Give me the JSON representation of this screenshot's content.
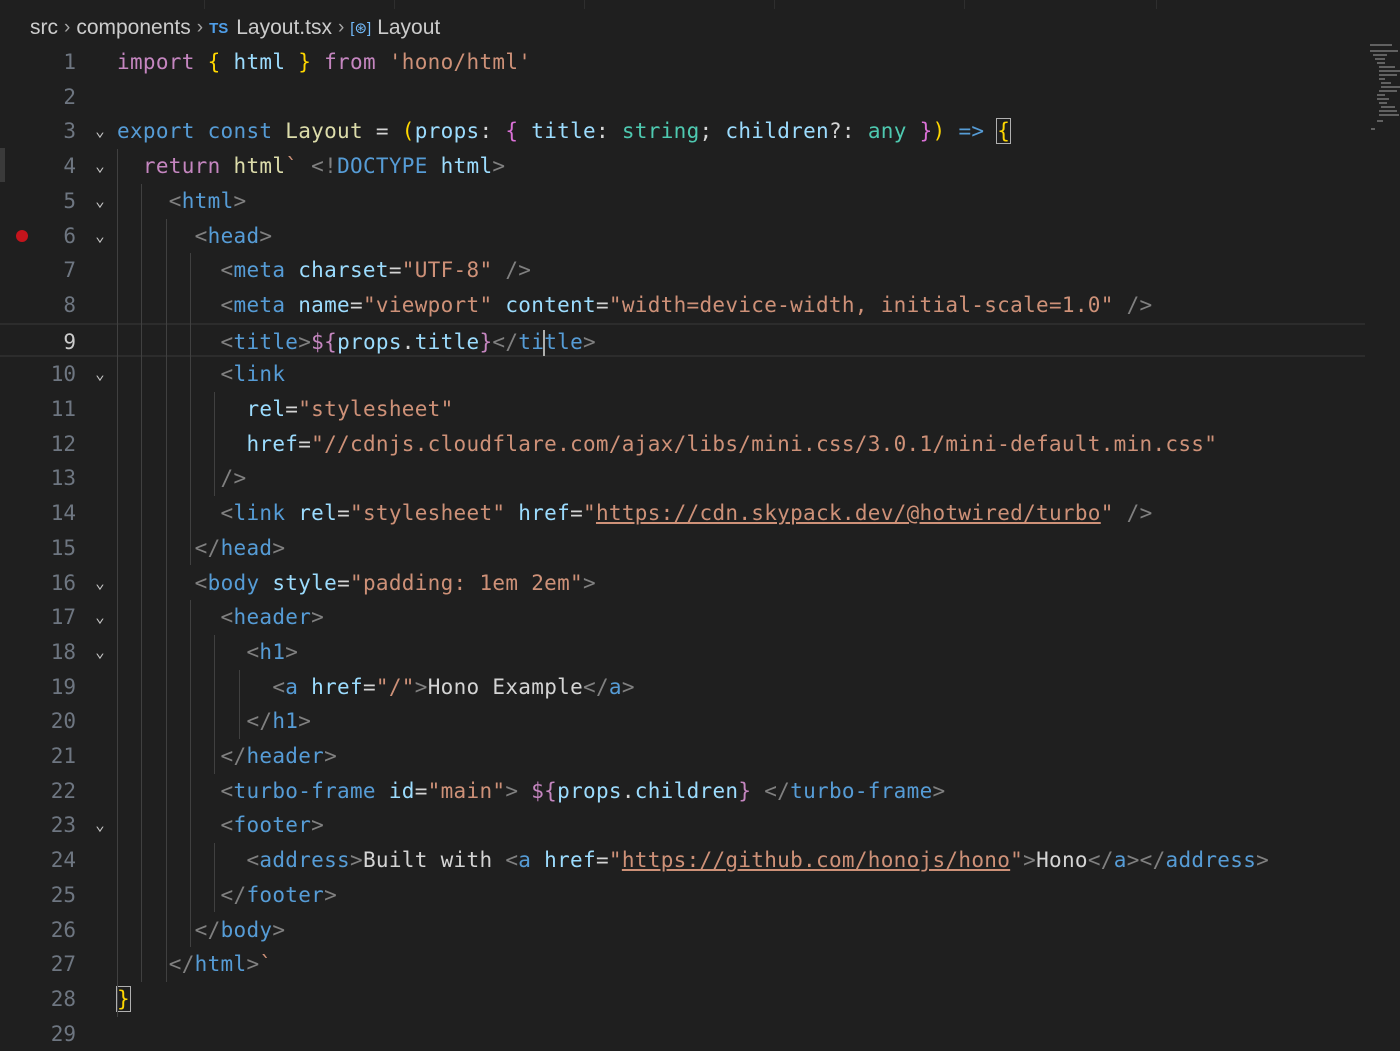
{
  "breadcrumb": {
    "items": [
      {
        "label": "src",
        "badge": ""
      },
      {
        "label": "components",
        "badge": ""
      },
      {
        "label": "Layout.tsx",
        "badge": "TS"
      },
      {
        "label": "Layout",
        "badge": "symbol"
      }
    ]
  },
  "editor": {
    "current_line": 9,
    "breakpoint_line": 6,
    "lines": [
      {
        "n": "1",
        "fold": false,
        "tokens": [
          [
            "t-kw",
            "import "
          ],
          [
            "t-b1",
            "{ "
          ],
          [
            "t-id",
            "html"
          ],
          [
            "t-b1",
            " }"
          ],
          [
            "t-kw",
            " from "
          ],
          [
            "t-st",
            "'hono/html'"
          ]
        ]
      },
      {
        "n": "2",
        "fold": false,
        "tokens": []
      },
      {
        "n": "3",
        "fold": true,
        "tokens": [
          [
            "t-tg",
            "export "
          ],
          [
            "t-tg",
            "const "
          ],
          [
            "t-fn",
            "Layout"
          ],
          [
            "t-df",
            " = "
          ],
          [
            "t-b1",
            "("
          ],
          [
            "t-id",
            "props"
          ],
          [
            "t-df",
            ": "
          ],
          [
            "t-b2",
            "{ "
          ],
          [
            "t-id",
            "title"
          ],
          [
            "t-df",
            ": "
          ],
          [
            "t-ty",
            "string"
          ],
          [
            "t-df",
            "; "
          ],
          [
            "t-id",
            "children"
          ],
          [
            "t-df",
            "?: "
          ],
          [
            "t-ty",
            "any"
          ],
          [
            "t-b2",
            " }"
          ],
          [
            "t-b1",
            ")"
          ],
          [
            "t-tg",
            " => "
          ],
          [
            "t-b1 bm",
            "{"
          ]
        ]
      },
      {
        "n": "4",
        "fold": true,
        "tokens": [
          [
            "t-df",
            "  "
          ],
          [
            "t-kw",
            "return "
          ],
          [
            "t-fn",
            "html"
          ],
          [
            "t-st",
            "` "
          ],
          [
            "t-pu",
            "<!"
          ],
          [
            "t-tg",
            "DOCTYPE "
          ],
          [
            "t-id",
            "html"
          ],
          [
            "t-pu",
            ">"
          ]
        ]
      },
      {
        "n": "5",
        "fold": true,
        "tokens": [
          [
            "t-df",
            "    "
          ],
          [
            "t-pu",
            "<"
          ],
          [
            "t-tg",
            "html"
          ],
          [
            "t-pu",
            ">"
          ]
        ]
      },
      {
        "n": "6",
        "fold": true,
        "tokens": [
          [
            "t-df",
            "      "
          ],
          [
            "t-pu",
            "<"
          ],
          [
            "t-tg",
            "head"
          ],
          [
            "t-pu",
            ">"
          ]
        ]
      },
      {
        "n": "7",
        "fold": false,
        "tokens": [
          [
            "t-df",
            "        "
          ],
          [
            "t-pu",
            "<"
          ],
          [
            "t-tg",
            "meta "
          ],
          [
            "t-id",
            "charset"
          ],
          [
            "t-df",
            "="
          ],
          [
            "t-st",
            "\"UTF-8\""
          ],
          [
            "t-pu",
            " />"
          ]
        ]
      },
      {
        "n": "8",
        "fold": false,
        "tokens": [
          [
            "t-df",
            "        "
          ],
          [
            "t-pu",
            "<"
          ],
          [
            "t-tg",
            "meta "
          ],
          [
            "t-id",
            "name"
          ],
          [
            "t-df",
            "="
          ],
          [
            "t-st",
            "\"viewport\" "
          ],
          [
            "t-id",
            "content"
          ],
          [
            "t-df",
            "="
          ],
          [
            "t-st",
            "\"width=device-width, initial-scale=1.0\""
          ],
          [
            "t-pu",
            " />"
          ]
        ]
      },
      {
        "n": "9",
        "fold": false,
        "tokens": [
          [
            "t-df",
            "        "
          ],
          [
            "t-pu",
            "<"
          ],
          [
            "t-tg",
            "title"
          ],
          [
            "t-pu",
            ">"
          ],
          [
            "t-kw",
            "${"
          ],
          [
            "t-id",
            "props"
          ],
          [
            "t-df",
            "."
          ],
          [
            "t-id",
            "title"
          ],
          [
            "t-kw",
            "}"
          ],
          [
            "t-pu",
            "</"
          ],
          [
            "t-tg",
            "ti"
          ],
          [
            "caret",
            ""
          ],
          [
            "t-tg",
            "tle"
          ],
          [
            "t-pu",
            ">"
          ]
        ]
      },
      {
        "n": "10",
        "fold": true,
        "tokens": [
          [
            "t-df",
            "        "
          ],
          [
            "t-pu",
            "<"
          ],
          [
            "t-tg",
            "link"
          ]
        ]
      },
      {
        "n": "11",
        "fold": false,
        "tokens": [
          [
            "t-df",
            "          "
          ],
          [
            "t-id",
            "rel"
          ],
          [
            "t-df",
            "="
          ],
          [
            "t-st",
            "\"stylesheet\""
          ]
        ]
      },
      {
        "n": "12",
        "fold": false,
        "tokens": [
          [
            "t-df",
            "          "
          ],
          [
            "t-id",
            "href"
          ],
          [
            "t-df",
            "="
          ],
          [
            "t-st",
            "\"//cdnjs.cloudflare.com/ajax/libs/mini.css/3.0.1/mini-default.min.css\""
          ]
        ]
      },
      {
        "n": "13",
        "fold": false,
        "tokens": [
          [
            "t-df",
            "        "
          ],
          [
            "t-pu",
            "/>"
          ]
        ]
      },
      {
        "n": "14",
        "fold": false,
        "tokens": [
          [
            "t-df",
            "        "
          ],
          [
            "t-pu",
            "<"
          ],
          [
            "t-tg",
            "link "
          ],
          [
            "t-id",
            "rel"
          ],
          [
            "t-df",
            "="
          ],
          [
            "t-st",
            "\"stylesheet\" "
          ],
          [
            "t-id",
            "href"
          ],
          [
            "t-df",
            "="
          ],
          [
            "t-st",
            "\""
          ],
          [
            "t-ln",
            "https://cdn.skypack.dev/@hotwired/turbo"
          ],
          [
            "t-st",
            "\""
          ],
          [
            "t-pu",
            " />"
          ]
        ]
      },
      {
        "n": "15",
        "fold": false,
        "tokens": [
          [
            "t-df",
            "      "
          ],
          [
            "t-pu",
            "</"
          ],
          [
            "t-tg",
            "head"
          ],
          [
            "t-pu",
            ">"
          ]
        ]
      },
      {
        "n": "16",
        "fold": true,
        "tokens": [
          [
            "t-df",
            "      "
          ],
          [
            "t-pu",
            "<"
          ],
          [
            "t-tg",
            "body "
          ],
          [
            "t-id",
            "style"
          ],
          [
            "t-df",
            "="
          ],
          [
            "t-st",
            "\"padding: 1em 2em\""
          ],
          [
            "t-pu",
            ">"
          ]
        ]
      },
      {
        "n": "17",
        "fold": true,
        "tokens": [
          [
            "t-df",
            "        "
          ],
          [
            "t-pu",
            "<"
          ],
          [
            "t-tg",
            "header"
          ],
          [
            "t-pu",
            ">"
          ]
        ]
      },
      {
        "n": "18",
        "fold": true,
        "tokens": [
          [
            "t-df",
            "          "
          ],
          [
            "t-pu",
            "<"
          ],
          [
            "t-tg",
            "h1"
          ],
          [
            "t-pu",
            ">"
          ]
        ]
      },
      {
        "n": "19",
        "fold": false,
        "tokens": [
          [
            "t-df",
            "            "
          ],
          [
            "t-pu",
            "<"
          ],
          [
            "t-tg",
            "a "
          ],
          [
            "t-id",
            "href"
          ],
          [
            "t-df",
            "="
          ],
          [
            "t-st",
            "\"/\""
          ],
          [
            "t-pu",
            ">"
          ],
          [
            "t-df",
            "Hono Example"
          ],
          [
            "t-pu",
            "</"
          ],
          [
            "t-tg",
            "a"
          ],
          [
            "t-pu",
            ">"
          ]
        ]
      },
      {
        "n": "20",
        "fold": false,
        "tokens": [
          [
            "t-df",
            "          "
          ],
          [
            "t-pu",
            "</"
          ],
          [
            "t-tg",
            "h1"
          ],
          [
            "t-pu",
            ">"
          ]
        ]
      },
      {
        "n": "21",
        "fold": false,
        "tokens": [
          [
            "t-df",
            "        "
          ],
          [
            "t-pu",
            "</"
          ],
          [
            "t-tg",
            "header"
          ],
          [
            "t-pu",
            ">"
          ]
        ]
      },
      {
        "n": "22",
        "fold": false,
        "tokens": [
          [
            "t-df",
            "        "
          ],
          [
            "t-pu",
            "<"
          ],
          [
            "t-tg",
            "turbo-frame "
          ],
          [
            "t-id",
            "id"
          ],
          [
            "t-df",
            "="
          ],
          [
            "t-st",
            "\"main\""
          ],
          [
            "t-pu",
            "> "
          ],
          [
            "t-kw",
            "${"
          ],
          [
            "t-id",
            "props"
          ],
          [
            "t-df",
            "."
          ],
          [
            "t-id",
            "children"
          ],
          [
            "t-kw",
            "}"
          ],
          [
            "t-pu",
            " </"
          ],
          [
            "t-tg",
            "turbo-frame"
          ],
          [
            "t-pu",
            ">"
          ]
        ]
      },
      {
        "n": "23",
        "fold": true,
        "tokens": [
          [
            "t-df",
            "        "
          ],
          [
            "t-pu",
            "<"
          ],
          [
            "t-tg",
            "footer"
          ],
          [
            "t-pu",
            ">"
          ]
        ]
      },
      {
        "n": "24",
        "fold": false,
        "tokens": [
          [
            "t-df",
            "          "
          ],
          [
            "t-pu",
            "<"
          ],
          [
            "t-tg",
            "address"
          ],
          [
            "t-pu",
            ">"
          ],
          [
            "t-df",
            "Built with "
          ],
          [
            "t-pu",
            "<"
          ],
          [
            "t-tg",
            "a "
          ],
          [
            "t-id",
            "href"
          ],
          [
            "t-df",
            "="
          ],
          [
            "t-st",
            "\""
          ],
          [
            "t-ln",
            "https://github.com/honojs/hono"
          ],
          [
            "t-st",
            "\""
          ],
          [
            "t-pu",
            ">"
          ],
          [
            "t-df",
            "Hono"
          ],
          [
            "t-pu",
            "</"
          ],
          [
            "t-tg",
            "a"
          ],
          [
            "t-pu",
            "></"
          ],
          [
            "t-tg",
            "address"
          ],
          [
            "t-pu",
            ">"
          ]
        ]
      },
      {
        "n": "25",
        "fold": false,
        "tokens": [
          [
            "t-df",
            "        "
          ],
          [
            "t-pu",
            "</"
          ],
          [
            "t-tg",
            "footer"
          ],
          [
            "t-pu",
            ">"
          ]
        ]
      },
      {
        "n": "26",
        "fold": false,
        "tokens": [
          [
            "t-df",
            "      "
          ],
          [
            "t-pu",
            "</"
          ],
          [
            "t-tg",
            "body"
          ],
          [
            "t-pu",
            ">"
          ]
        ]
      },
      {
        "n": "27",
        "fold": false,
        "tokens": [
          [
            "t-df",
            "    "
          ],
          [
            "t-pu",
            "</"
          ],
          [
            "t-tg",
            "html"
          ],
          [
            "t-pu",
            ">"
          ],
          [
            "t-st",
            "`"
          ]
        ]
      },
      {
        "n": "28",
        "fold": false,
        "tokens": [
          [
            "t-b1 bm",
            "}"
          ]
        ]
      },
      {
        "n": "29",
        "fold": false,
        "tokens": []
      }
    ]
  }
}
